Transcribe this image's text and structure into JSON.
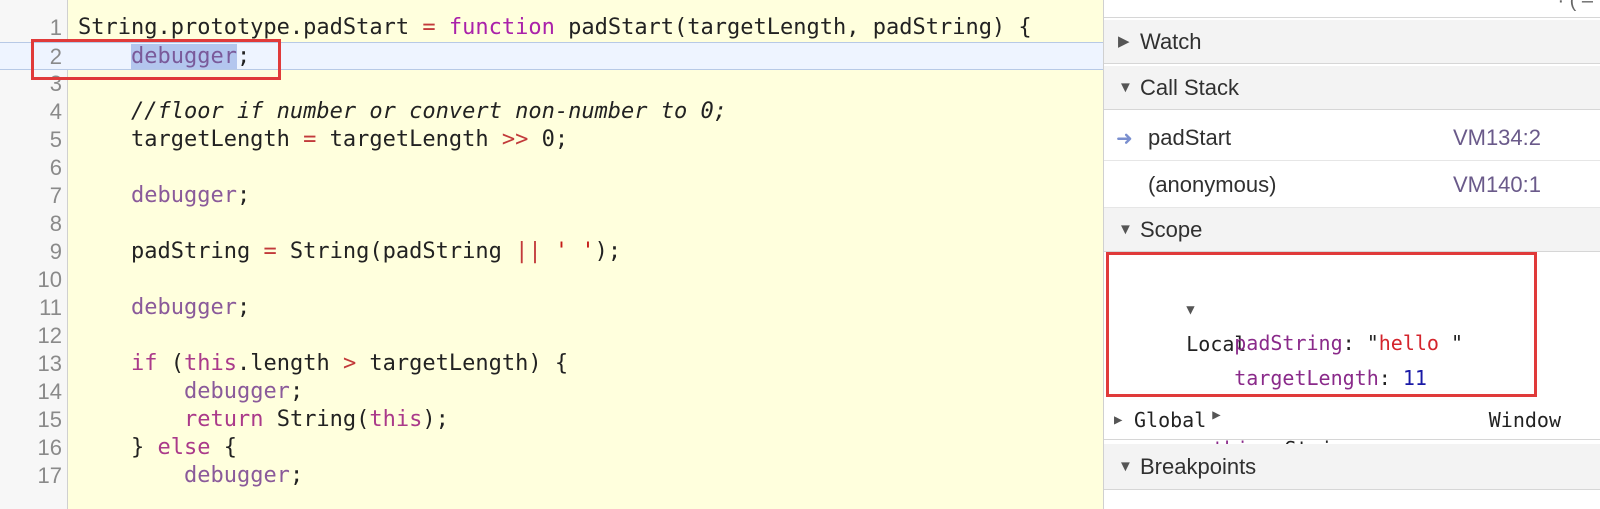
{
  "editor": {
    "lines": [
      {
        "num": "1",
        "segments": [
          {
            "t": "String.prototype.padStart ",
            "c": "plain"
          },
          {
            "t": "=",
            "c": "op"
          },
          {
            "t": " ",
            "c": "plain"
          },
          {
            "t": "function",
            "c": "fn"
          },
          {
            "t": " padStart(targetLength, padString) {",
            "c": "plain"
          }
        ]
      },
      {
        "num": "2",
        "current": true,
        "segments": [
          {
            "t": "    ",
            "c": "plain"
          },
          {
            "t": "debugger",
            "c": "sel"
          },
          {
            "t": ";",
            "c": "plain"
          }
        ]
      },
      {
        "num": "3",
        "segments": []
      },
      {
        "num": "4",
        "segments": [
          {
            "t": "    //floor if number or convert non-number to 0;",
            "c": "cm"
          }
        ]
      },
      {
        "num": "5",
        "segments": [
          {
            "t": "    targetLength ",
            "c": "plain"
          },
          {
            "t": "=",
            "c": "op"
          },
          {
            "t": " targetLength ",
            "c": "plain"
          },
          {
            "t": ">>",
            "c": "op"
          },
          {
            "t": " 0;",
            "c": "plain"
          }
        ]
      },
      {
        "num": "6",
        "segments": []
      },
      {
        "num": "7",
        "segments": [
          {
            "t": "    ",
            "c": "plain"
          },
          {
            "t": "debugger",
            "c": "purple"
          },
          {
            "t": ";",
            "c": "plain"
          }
        ]
      },
      {
        "num": "8",
        "segments": []
      },
      {
        "num": "9",
        "segments": [
          {
            "t": "    padString ",
            "c": "plain"
          },
          {
            "t": "=",
            "c": "op"
          },
          {
            "t": " String(padString ",
            "c": "plain"
          },
          {
            "t": "||",
            "c": "op"
          },
          {
            "t": " ",
            "c": "plain"
          },
          {
            "t": "' '",
            "c": "str"
          },
          {
            "t": ");",
            "c": "plain"
          }
        ]
      },
      {
        "num": "10",
        "segments": []
      },
      {
        "num": "11",
        "segments": [
          {
            "t": "    ",
            "c": "plain"
          },
          {
            "t": "debugger",
            "c": "purple"
          },
          {
            "t": ";",
            "c": "plain"
          }
        ]
      },
      {
        "num": "12",
        "segments": []
      },
      {
        "num": "13",
        "segments": [
          {
            "t": "    ",
            "c": "plain"
          },
          {
            "t": "if",
            "c": "kw"
          },
          {
            "t": " (",
            "c": "plain"
          },
          {
            "t": "this",
            "c": "kw"
          },
          {
            "t": ".length ",
            "c": "plain"
          },
          {
            "t": ">",
            "c": "op"
          },
          {
            "t": " targetLength) {",
            "c": "plain"
          }
        ]
      },
      {
        "num": "14",
        "segments": [
          {
            "t": "        ",
            "c": "plain"
          },
          {
            "t": "debugger",
            "c": "purple"
          },
          {
            "t": ";",
            "c": "plain"
          }
        ]
      },
      {
        "num": "15",
        "segments": [
          {
            "t": "        ",
            "c": "plain"
          },
          {
            "t": "return",
            "c": "kw"
          },
          {
            "t": " String(",
            "c": "plain"
          },
          {
            "t": "this",
            "c": "kw"
          },
          {
            "t": ");",
            "c": "plain"
          }
        ]
      },
      {
        "num": "16",
        "segments": [
          {
            "t": "    } ",
            "c": "plain"
          },
          {
            "t": "else",
            "c": "kw"
          },
          {
            "t": " {",
            "c": "plain"
          }
        ]
      },
      {
        "num": "17",
        "segments": [
          {
            "t": "        ",
            "c": "plain"
          },
          {
            "t": "debugger",
            "c": "purple"
          },
          {
            "t": ";",
            "c": "plain"
          }
        ]
      }
    ]
  },
  "sidebar": {
    "top_clip": "· ( –",
    "watch_label": "Watch",
    "call_stack_label": "Call Stack",
    "stack": [
      {
        "name": "padStart",
        "location": "VM134:2",
        "active": true
      },
      {
        "name": "(anonymous)",
        "location": "VM140:1",
        "active": false
      }
    ],
    "scope_label": "Scope",
    "local": {
      "label": "Local",
      "pad_key": "padString",
      "pad_quote_open": "\"",
      "pad_value": "hello",
      "pad_quote_close": " \"",
      "target_key": "targetLength",
      "target_value": "11",
      "this_key": "this",
      "this_value": "String"
    },
    "global": {
      "label": "Global",
      "value": "Window"
    },
    "breakpoints_label": "Breakpoints"
  },
  "colors": {
    "annotation": "#e03a3a",
    "editor_bg": "#ffffdd",
    "keyword": "#aa3a8a",
    "string_value": "#d4242c"
  }
}
